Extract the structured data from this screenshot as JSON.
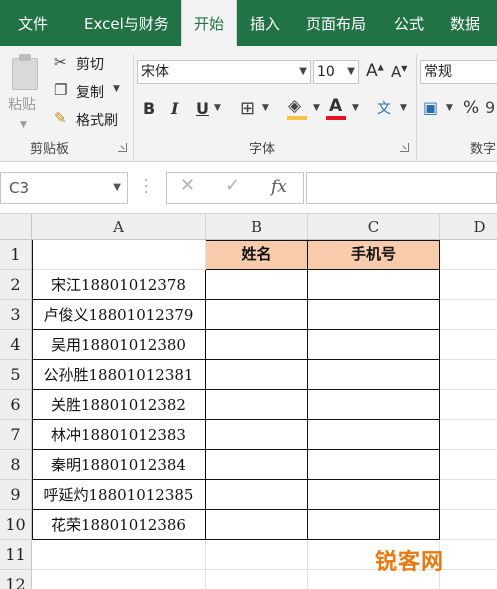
{
  "menu": {
    "tabs": [
      "文件",
      "Excel与财务",
      "开始",
      "插入",
      "页面布局",
      "公式",
      "数据"
    ],
    "active_tab": "开始"
  },
  "ribbon": {
    "clipboard": {
      "paste_label": "粘贴",
      "cut_label": "剪切",
      "copy_label": "复制",
      "format_painter_label": "格式刷",
      "group_label": "剪贴板"
    },
    "font": {
      "font_name": "宋体",
      "font_size": "10",
      "bold": "B",
      "italic": "I",
      "underline": "U",
      "font_color_glyph": "A",
      "phonetic_glyph": "文",
      "group_label": "字体",
      "grow_glyph": "A",
      "shrink_glyph": "A"
    },
    "number": {
      "format": "常规",
      "percent": "%",
      "group_label": "数字"
    },
    "colors": {
      "highlight": "#f6c343",
      "font_color": "#e81123",
      "accent": "#217346"
    }
  },
  "formula_bar": {
    "name_box": "C3",
    "fx": "fx",
    "cancel_glyph": "✕",
    "enter_glyph": "✓",
    "formula": ""
  },
  "sheet": {
    "columns": [
      "A",
      "B",
      "C",
      "D"
    ],
    "rows": [
      "1",
      "2",
      "3",
      "4",
      "5",
      "6",
      "7",
      "8",
      "9",
      "10",
      "11",
      "12"
    ],
    "headers": {
      "B1": "姓名",
      "C1": "手机号"
    },
    "header_fill": "#f8cbad",
    "column_a": [
      "宋江18801012378",
      "卢俊义18801012379",
      "吴用18801012380",
      "公孙胜18801012381",
      "关胜18801012382",
      "林冲18801012383",
      "秦明18801012384",
      "呼延灼18801012385",
      "花荣18801012386"
    ]
  },
  "watermark": "锐客网"
}
